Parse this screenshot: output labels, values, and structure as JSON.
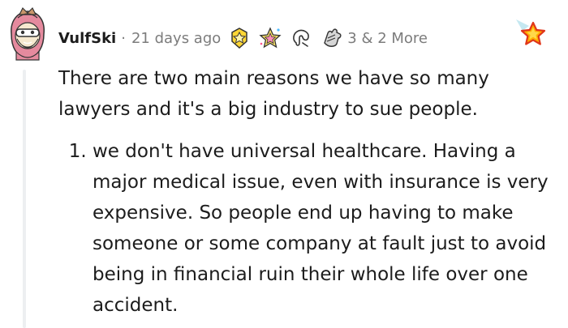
{
  "comment": {
    "username": "VulfSki",
    "separator": "·",
    "time": "21 days ago",
    "awards": {
      "icons": [
        "helpful-medal-icon",
        "wholesome-star-icon",
        "silver-icon",
        "hand-icon"
      ],
      "more_text": "3 & 2 More"
    },
    "paragraph": "There are two main reasons we have so many lawyers and it's a big industry to sue people.",
    "list": [
      "we don't have universal healthcare. Having a major medical issue, even with insurance is very expensive. So people end up having to make someone or some company at fault just to avoid being in financial ruin their whole life over one accident."
    ]
  },
  "gift_button": {
    "icon": "award-star-icon"
  },
  "colors": {
    "text": "#1c1c1c",
    "meta": "#7c7c7c",
    "thread_line": "#edeff1",
    "star_gold": "#ffb000"
  }
}
